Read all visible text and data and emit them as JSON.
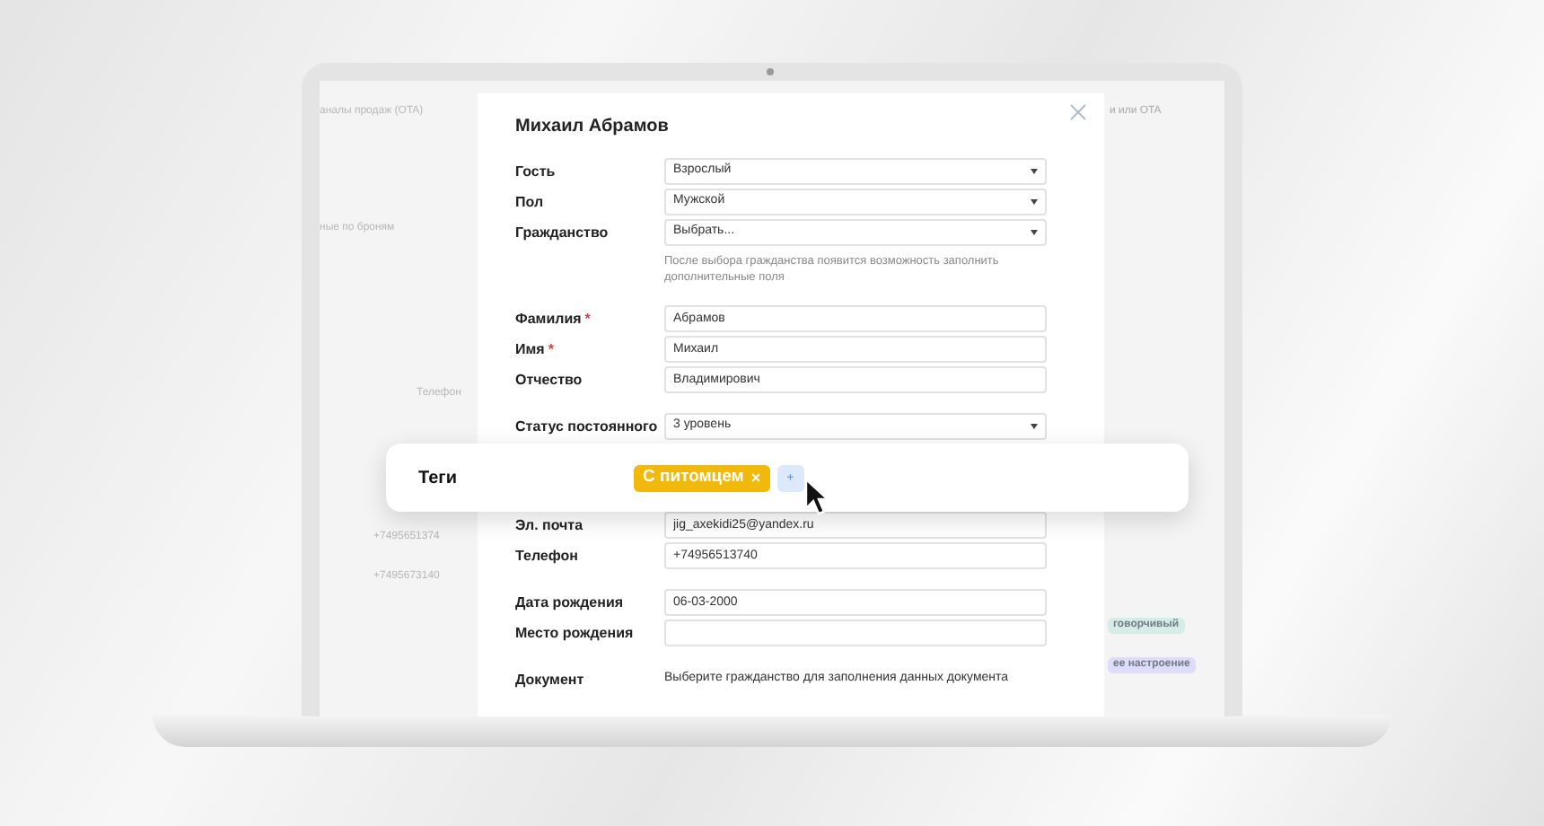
{
  "background_app": {
    "left_texts": [
      {
        "text": "аналы продаж (OTA)",
        "kind": "tab"
      },
      {
        "text": "ные по броням",
        "kind": "tab"
      },
      {
        "text": "Телефон",
        "kind": "header"
      },
      {
        "text": "+7495651374",
        "kind": "cell"
      },
      {
        "text": "+7495673140",
        "kind": "cell"
      }
    ],
    "right_texts": [
      {
        "text": "и или OTA"
      }
    ],
    "right_tags": [
      {
        "text": "говорчивый",
        "color": "#d5ede6"
      },
      {
        "text": "ее настроение",
        "color": "#dedcf8"
      }
    ]
  },
  "modal": {
    "title": "Михаил Абрамов",
    "groups": [
      [
        {
          "kind": "select",
          "label": "Гость",
          "value": "Взрослый"
        },
        {
          "kind": "select",
          "label": "Пол",
          "value": "Мужской"
        },
        {
          "kind": "select",
          "label": "Гражданство",
          "value": "Выбрать..."
        },
        {
          "kind": "hint",
          "text": "После выбора гражданства появится возможность заполнить дополнительные поля"
        }
      ],
      [
        {
          "kind": "input",
          "label": "Фамилия",
          "value": "Абрамов",
          "required_mark": "*"
        },
        {
          "kind": "input",
          "label": "Имя",
          "value": "Михаил",
          "required_mark": "*"
        },
        {
          "kind": "input",
          "label": "Отчество",
          "value": "Владимирович"
        }
      ],
      [
        {
          "kind": "select",
          "label": "Статус постоянного",
          "value": "3 уровень"
        }
      ],
      [
        {
          "kind": "input",
          "label": "Эл. почта",
          "value": "jig_axekidi25@yandex.ru"
        },
        {
          "kind": "input",
          "label": "Телефон",
          "value": "+74956513740"
        }
      ],
      [
        {
          "kind": "input",
          "label": "Дата рождения",
          "value": "06-03-2000"
        },
        {
          "kind": "input",
          "label": "Место рождения"
        }
      ],
      [
        {
          "kind": "text",
          "label": "Документ",
          "value": "Выберите гражданство для заполнения данных документа"
        }
      ]
    ]
  },
  "tags_card": {
    "label": "Теги",
    "tags": [
      {
        "text": "С питомцем",
        "remove": "×"
      }
    ],
    "add": "+"
  }
}
